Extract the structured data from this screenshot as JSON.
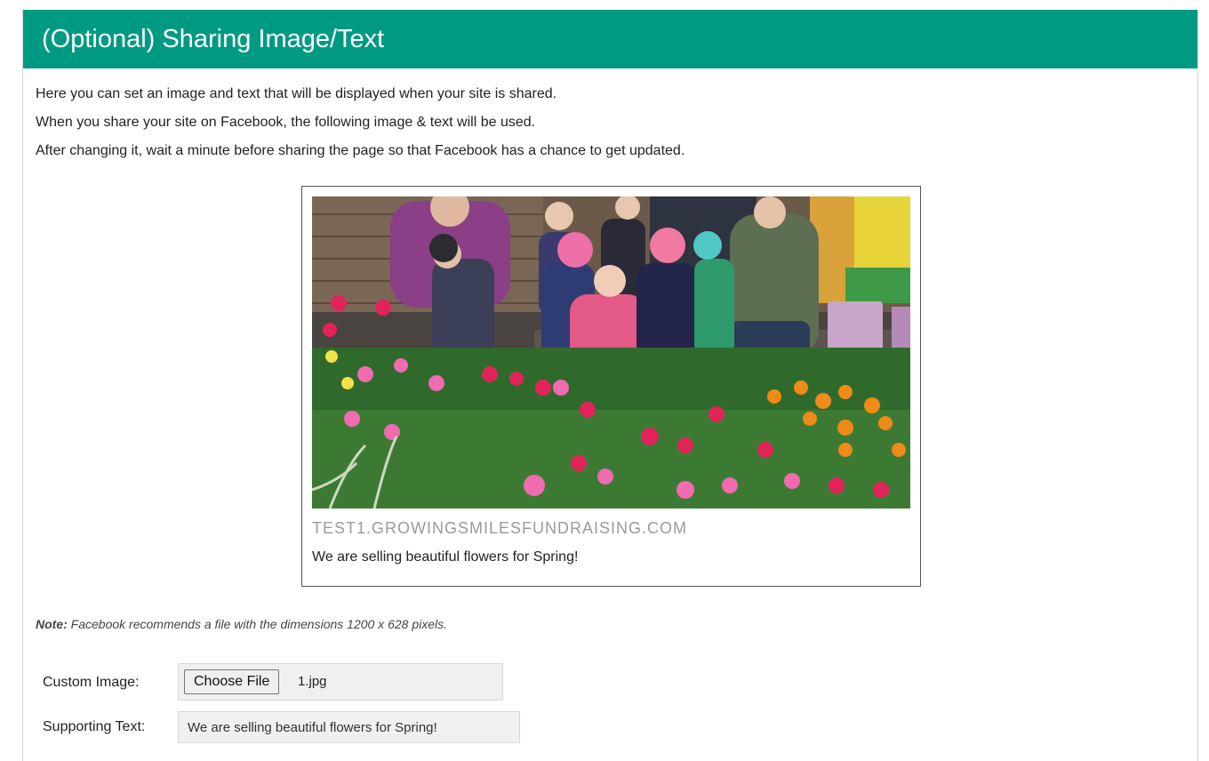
{
  "header": {
    "title": "(Optional) Sharing Image/Text"
  },
  "intro": {
    "line1": "Here you can set an image and text that will be displayed when your site is shared.",
    "line2": "When you share your site on Facebook, the following image & text will be used.",
    "line3": "After changing it, wait a minute before sharing the page so that Facebook has a chance to get updated."
  },
  "preview": {
    "domain": "TEST1.GROWINGSMILESFUNDRAISING.COM",
    "text": "We are selling beautiful flowers for Spring!"
  },
  "note": {
    "label": "Note:",
    "text": " Facebook recommends a file with the dimensions 1200 x 628 pixels."
  },
  "form": {
    "custom_image_label": "Custom Image:",
    "choose_file_label": "Choose File",
    "file_name": "1.jpg",
    "supporting_text_label": "Supporting Text:",
    "supporting_text_value": "We are selling beautiful flowers for Spring!"
  },
  "colors": {
    "header_bg": "#009a82",
    "header_text": "#ffffff"
  }
}
